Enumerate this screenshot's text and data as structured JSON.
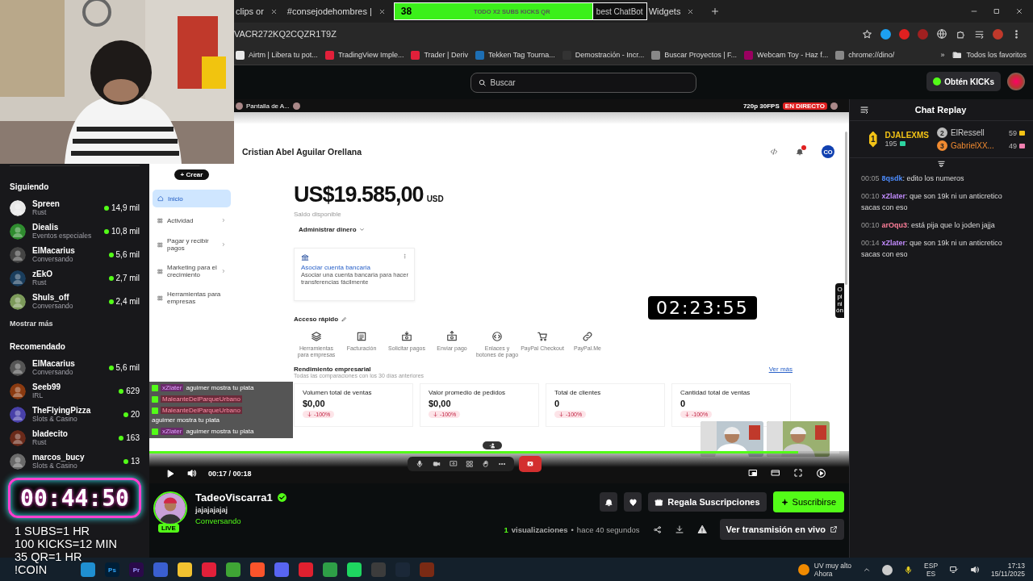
{
  "browser": {
    "tabs": [
      {
        "label": "clips or"
      },
      {
        "label": "#consejodehombres |"
      }
    ],
    "banner": {
      "count": "38",
      "text": "TODO X2 SUBS KICKS QR"
    },
    "tab_fragment": "best ChatBot",
    "last_tab": "Widgets",
    "address": "VACR272KQ2CQZR1T9Z",
    "bookmarks": [
      "Airtm | Libera tu pot...",
      "TradingView Imple...",
      "Trader | Deriv",
      "Tekken Tag Tourna...",
      "Demostración - Incr...",
      "Buscar Proyectos | F...",
      "Webcam Toy - Haz f...",
      "chrome://dino/"
    ],
    "bookmarks_more": "»",
    "all_bookmarks": "Todos los favoritos"
  },
  "header": {
    "search_placeholder": "Buscar",
    "kicks_button": "Obtén KICKs"
  },
  "sidebar": {
    "sections": [
      {
        "title": "Siguiendo",
        "more": "Mostrar más",
        "channels": [
          {
            "name": "Spreen",
            "category": "Rust",
            "viewers": "14,9 mil"
          },
          {
            "name": "Diealis",
            "category": "Eventos especiales",
            "viewers": "10,8 mil"
          },
          {
            "name": "ElMacarius",
            "category": "Conversando",
            "viewers": "5,6 mil"
          },
          {
            "name": "zEkO",
            "category": "Rust",
            "viewers": "2,7 mil"
          },
          {
            "name": "Shuls_off",
            "category": "Conversando",
            "viewers": "2,4 mil"
          }
        ]
      },
      {
        "title": "Recomendado",
        "channels": [
          {
            "name": "ElMacarius",
            "category": "Conversando",
            "viewers": "5,6 mil"
          },
          {
            "name": "Seeb99",
            "category": "IRL",
            "viewers": "629"
          },
          {
            "name": "TheFlyingPizza",
            "category": "Slots & Casino",
            "viewers": "20"
          },
          {
            "name": "bladecito",
            "category": "Rust",
            "viewers": "163"
          },
          {
            "name": "marcos_bucy",
            "category": "Slots & Casino",
            "viewers": "13"
          }
        ]
      }
    ]
  },
  "stream_timer": {
    "time": "00:44:50",
    "rules": [
      "1 SUBS=1 HR",
      "100 KICKS=12 MIN",
      "35 QR=1 HR",
      "!COIN"
    ]
  },
  "video": {
    "screen_title": "Pantalla de A...",
    "quality": "720p 30FPS",
    "live_badge": "EN DIRECTO",
    "create_button": "+ Crear",
    "nav": [
      {
        "label": "Inicio",
        "selected": true
      },
      {
        "label": "Actividad",
        "selected": false
      },
      {
        "label": "Pagar y recibir pagos",
        "selected": false
      },
      {
        "label": "Marketing para el crecimiento",
        "selected": false
      },
      {
        "label": "Herramientas para empresas",
        "selected": false
      }
    ],
    "account_name": "Cristian Abel Aguilar Orellana",
    "account_initials": "CO",
    "balance": "US$19.585,00",
    "currency": "USD",
    "balance_label": "Saldo disponible",
    "manage": "Administrar dinero",
    "bank_card": {
      "title": "Asociar cuenta bancaria",
      "text": "Asociar una cuenta bancaria para hacer transferencias fácilmente"
    },
    "quick_title": "Acceso rápido",
    "quick_items": [
      {
        "kind": "layers",
        "label": "Herramientas para empresas"
      },
      {
        "kind": "invoice",
        "label": "Facturación"
      },
      {
        "kind": "request",
        "label": "Solicitar pagos"
      },
      {
        "kind": "send",
        "label": "Enviar pago"
      },
      {
        "kind": "code",
        "label": "Enlaces y botones de pago"
      },
      {
        "kind": "cart",
        "label": "PayPal Checkout"
      },
      {
        "kind": "link",
        "label": "PayPal.Me"
      }
    ],
    "performance_title": "Rendimiento empresarial",
    "performance_subtitle": "Todas las comparaciones con los 30 días anteriores",
    "more": "Ver más",
    "stats": [
      {
        "label": "Volumen total de ventas",
        "value": "$0,00",
        "change": "-100%"
      },
      {
        "label": "Valor promedio de pedidos",
        "value": "$0,00",
        "change": "-100%"
      },
      {
        "label": "Total de clientes",
        "value": "0",
        "change": "-100%"
      },
      {
        "label": "Cantidad total de ventas",
        "value": "0",
        "change": "-100%"
      }
    ],
    "timer": "02:23:55",
    "feedback_tab": "Opinión",
    "chat_overlay": [
      {
        "user": "xZlater",
        "text": "aguimer mostra tu plata"
      },
      {
        "user": "MaleanteDelParqueUrbano"
      },
      {
        "user": "MaleanteDelParqueUrbano",
        "text": "aguimer mostra tu plata"
      },
      {
        "user": "xZlater",
        "text": "aguimer mostra tu plata"
      }
    ],
    "time": "00:17 / 00:18",
    "progress": {
      "level": 0.94
    }
  },
  "channel": {
    "avatar_badge": "LIVE",
    "name": "TadeoViscarra1",
    "verified": true,
    "title": "jajajajajaj",
    "category": "Conversando",
    "gift_button": "Regala Suscripciones",
    "subscribe_button": "Suscribirse",
    "views_count": "1",
    "views_label": "visualizaciones",
    "separator": "•",
    "time_ago": "hace 40 segundos",
    "watch_live": "Ver transmisión en vivo"
  },
  "chat": {
    "title": "Chat Replay",
    "separator": ":",
    "leaders": [
      {
        "rank": "1",
        "name": "DJALEXMS",
        "score": "195"
      },
      {
        "rank": "2",
        "name": "ElRessell",
        "score": "59"
      },
      {
        "rank": "3",
        "name": "GabrielXX...",
        "score": "49"
      }
    ],
    "messages": [
      {
        "time": "00:05",
        "user": "8qsdk",
        "color": "#4d8dff",
        "text": "edito los numeros"
      },
      {
        "time": "00:10",
        "user": "xZlater",
        "color": "#c38cff",
        "text": "que son 19k ni un anticretico sacas con eso"
      },
      {
        "time": "00:10",
        "user": "arOqu3",
        "color": "#ff7f9a",
        "text": "está pija que lo joden jajja"
      },
      {
        "time": "00:14",
        "user": "xZlater",
        "color": "#c38cff",
        "text": "que son 19k ni un anticretico sacas con eso"
      }
    ]
  },
  "taskbar": {
    "apps": [
      {
        "kind": "edge"
      },
      {
        "kind": "photoshop",
        "label": "Ps"
      },
      {
        "kind": "premiere",
        "label": "Pr"
      },
      {
        "kind": "store"
      },
      {
        "kind": "folder"
      },
      {
        "kind": "deriv"
      },
      {
        "kind": "minecraft"
      },
      {
        "kind": "brave"
      },
      {
        "kind": "discord"
      },
      {
        "kind": "opera"
      },
      {
        "kind": "chrome"
      },
      {
        "kind": "spotify"
      },
      {
        "kind": "obs"
      },
      {
        "kind": "steam"
      },
      {
        "kind": "game"
      }
    ],
    "weather": {
      "text": "UV muy alto",
      "sub": "Ahora"
    },
    "language": {
      "top": "ESP",
      "bottom": "ES"
    },
    "clock": {
      "time": "17:13",
      "date": "15/11/2025"
    }
  }
}
